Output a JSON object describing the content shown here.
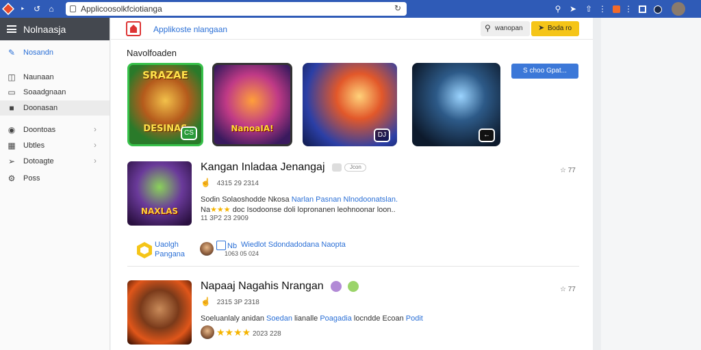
{
  "browser": {
    "url": "Applicoosolkfciotianga",
    "left_icons": [
      "app-logo-icon",
      "menu-chevron-icon",
      "back-icon",
      "home-icon"
    ],
    "right_icons": [
      "search-icon",
      "pin-icon",
      "bookmark-icon",
      "overflow-icon",
      "extension-icon",
      "panel-icon",
      "dark-mode-icon",
      "avatar"
    ]
  },
  "sidebar": {
    "title": "Nolnaasja",
    "items": [
      {
        "label": "Nosandn",
        "icon": "pencil-icon",
        "active": true
      },
      {
        "label": "Naunaan",
        "icon": "book-icon"
      },
      {
        "label": "Soaadgnaan",
        "icon": "monitor-icon"
      },
      {
        "label": "Doonasan",
        "icon": "folder-icon",
        "shaded": true
      },
      {
        "label": "Doontoas",
        "icon": "globe-icon",
        "chevron": true
      },
      {
        "label": "Ubtles",
        "icon": "grid-icon",
        "chevron": true
      },
      {
        "label": "Dotoagte",
        "icon": "tag-icon",
        "chevron": true
      },
      {
        "label": "Poss",
        "icon": "gear-icon"
      }
    ]
  },
  "header": {
    "app_title": "Applikoste nlangaan",
    "search_label": "wanopan",
    "shop_label": "Boda ro"
  },
  "featured": {
    "title": "Navolfoaden",
    "see_all": "S choo Gpat...",
    "tiles": [
      {
        "top_text": "SRAZAE",
        "bottom_text": "DESINAS",
        "badge": "CS",
        "name": "featured-game-1"
      },
      {
        "bottom_text": "NanoaIA!",
        "name": "featured-game-2"
      },
      {
        "badge": "DJ",
        "name": "featured-game-3"
      },
      {
        "badge": "←",
        "name": "featured-game-4"
      }
    ]
  },
  "games": [
    {
      "name": "Kangan Inladaa Jenangaj",
      "tag": "Jcon",
      "meta": "4315 29 2314",
      "rank": "77",
      "desc_plain": "Sodin Solaoshodde Nkosa",
      "desc_link": "Narlan Pasnan Nlnodoonatslan.",
      "desc2_prefix": "Na",
      "desc2_suffix": "doc Isodoonse doli lopronanen leohnoonar loon..",
      "date": "11 3P2 23 2909",
      "icon_text": "NAXLAS",
      "developer_line1": "Uaolgh",
      "developer_line2": "Pangana",
      "review_title": "Wiedlot Sdondadodana Naopta",
      "review_date": "1063 05 024",
      "review_mini": "Nb"
    },
    {
      "name": "Napaaj Nagahis Nrangan",
      "meta": "2315 3P 2318",
      "rank": "77",
      "desc_plain": "Soeluanlaly anidan",
      "desc_mid": "Soedan",
      "desc_plain2": "lianalle",
      "desc_link": "Poagadia",
      "desc_tail": "locndde Ecoan",
      "desc_link2": "Podit",
      "date": "2023 228"
    }
  ]
}
